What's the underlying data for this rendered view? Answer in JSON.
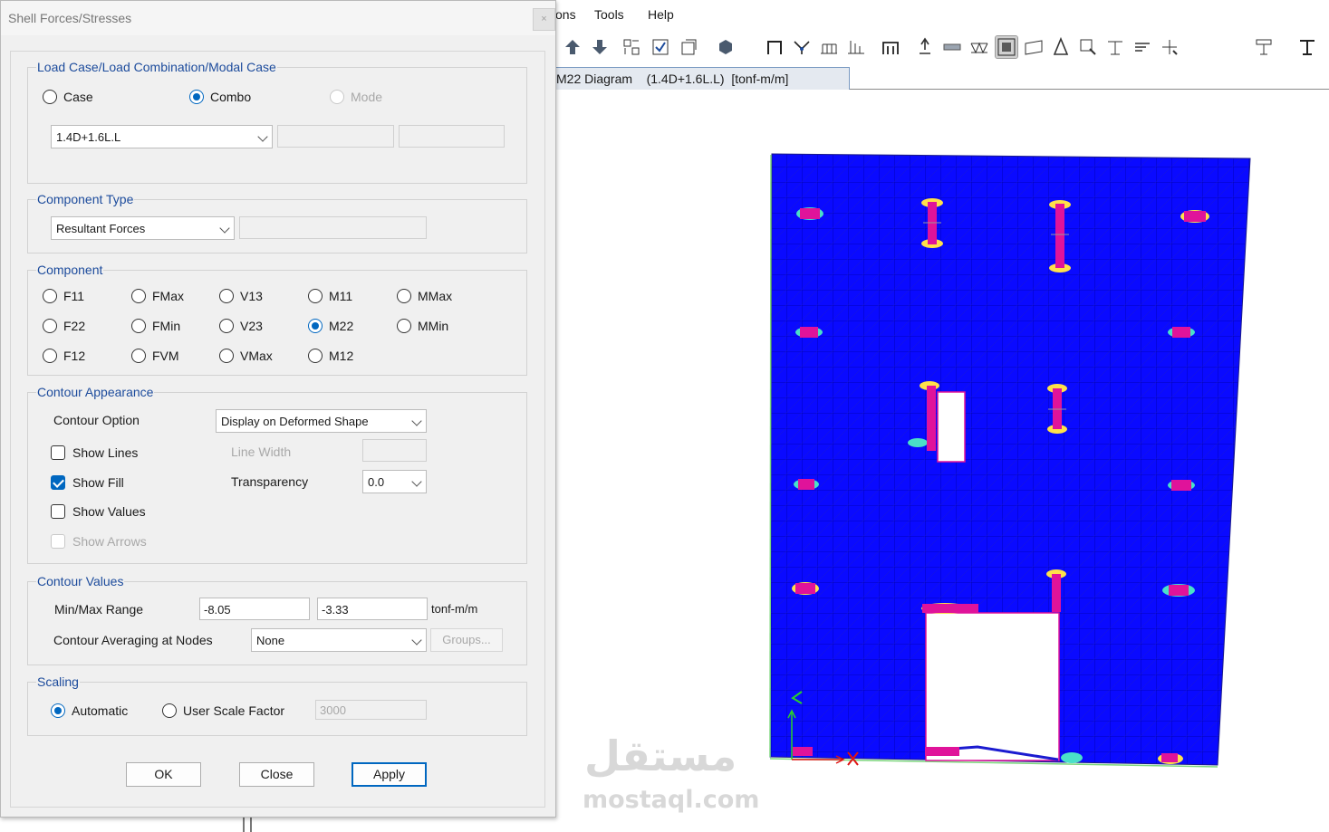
{
  "menu": {
    "items": [
      "ons",
      "Tools",
      "Help"
    ]
  },
  "tab": {
    "label": "M22 Diagram    (1.4D+1.6L.L)  [tonf-m/m]"
  },
  "toolbar": {
    "icons": [
      "move-up-icon",
      "move-down-icon",
      "select-icon",
      "check-icon",
      "rotate-view-icon",
      "3d-box-icon",
      "frame-icon",
      "release-icon",
      "beam-grid-icon",
      "column-grid-icon",
      "portal-icon",
      "support-icon",
      "slab-icon",
      "truss-icon",
      "shell-view-icon",
      "wall-icon",
      "tower-icon",
      "zoom-window-icon",
      "crane-icon",
      "rebar-icon",
      "pointer-dims-icon",
      "assign-icon",
      "section-icon"
    ]
  },
  "watermark": {
    "logo": "مستقل",
    "text": "mostaql.com"
  },
  "dialog": {
    "title": "Shell Forces/Stresses",
    "close_label": "×",
    "load_case": {
      "group_label": "Load Case/Load Combination/Modal Case",
      "options": {
        "case": "Case",
        "combo": "Combo",
        "mode": "Mode"
      },
      "selected": "Combo",
      "value": "1.4D+1.6L.L"
    },
    "component_type": {
      "group_label": "Component Type",
      "value": "Resultant Forces"
    },
    "component": {
      "group_label": "Component",
      "options": {
        "f11": "F11",
        "fmax": "FMax",
        "v13": "V13",
        "m11": "M11",
        "mmax": "MMax",
        "f22": "F22",
        "fmin": "FMin",
        "v23": "V23",
        "m22": "M22",
        "mmin": "MMin",
        "f12": "F12",
        "fvm": "FVM",
        "vmax": "VMax",
        "m12": "M12"
      },
      "selected": "M22"
    },
    "contour_appearance": {
      "group_label": "Contour Appearance",
      "contour_option_label": "Contour Option",
      "contour_option_value": "Display on Deformed Shape",
      "show_lines": "Show Lines",
      "show_fill": "Show Fill",
      "show_values": "Show Values",
      "show_arrows": "Show Arrows",
      "line_width_label": "Line Width",
      "transparency_label": "Transparency",
      "transparency_value": "0.0",
      "checked": {
        "show_lines": false,
        "show_fill": true,
        "show_values": false,
        "show_arrows": false
      }
    },
    "contour_values": {
      "group_label": "Contour Values",
      "range_label": "Min/Max Range",
      "min": "-8.05",
      "max": "-3.33",
      "unit": "tonf-m/m",
      "averaging_label": "Contour Averaging at Nodes",
      "averaging_value": "None",
      "groups_button": "Groups..."
    },
    "scaling": {
      "group_label": "Scaling",
      "automatic": "Automatic",
      "user_scale": "User Scale Factor",
      "user_scale_value": "3000",
      "selected": "Automatic"
    },
    "buttons": {
      "ok": "OK",
      "close": "Close",
      "apply": "Apply"
    }
  },
  "colors": {
    "accent": "#0067c0",
    "group_label": "#1c4b9c",
    "slab_fill": "#0a0aff",
    "grid_line": "#0000a8",
    "column_magenta": "#e0139a"
  }
}
